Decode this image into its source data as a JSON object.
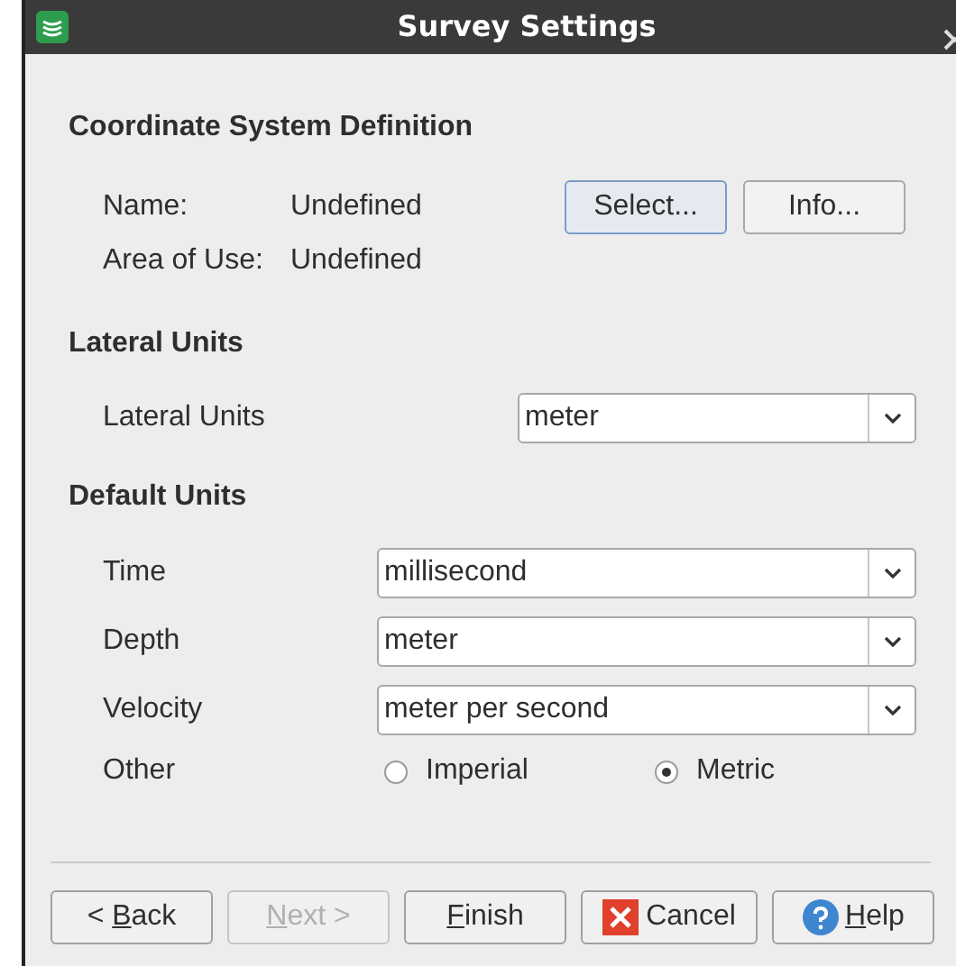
{
  "window": {
    "title": "Survey Settings"
  },
  "coordinate_system": {
    "heading": "Coordinate System Definition",
    "name_label": "Name:",
    "name_value": "Undefined",
    "area_label": "Area of Use:",
    "area_value": "Undefined",
    "buttons": [
      {
        "label": "Select...",
        "focused": true
      },
      {
        "label": "Info...",
        "focused": false
      }
    ]
  },
  "lateral_units": {
    "heading": "Lateral Units",
    "label": "Lateral Units",
    "value": "meter"
  },
  "default_units": {
    "heading": "Default Units",
    "rows": [
      {
        "label": "Time",
        "value": "millisecond"
      },
      {
        "label": "Depth",
        "value": "meter"
      },
      {
        "label": "Velocity",
        "value": "meter per second"
      }
    ],
    "other": {
      "label": "Other",
      "options": [
        {
          "label": "Imperial",
          "selected": false
        },
        {
          "label": "Metric",
          "selected": true
        }
      ]
    }
  },
  "buttons": [
    {
      "kind": "plain",
      "before": "< ",
      "key": "B",
      "after": "ack",
      "disabled": false
    },
    {
      "kind": "plain",
      "key": "N",
      "after": "ext >",
      "disabled": true
    },
    {
      "kind": "plain",
      "key": "F",
      "after": "inish",
      "disabled": false
    },
    {
      "kind": "cancel",
      "after": "Cancel",
      "disabled": false
    },
    {
      "kind": "help",
      "key": "H",
      "after": "elp",
      "disabled": false
    }
  ]
}
